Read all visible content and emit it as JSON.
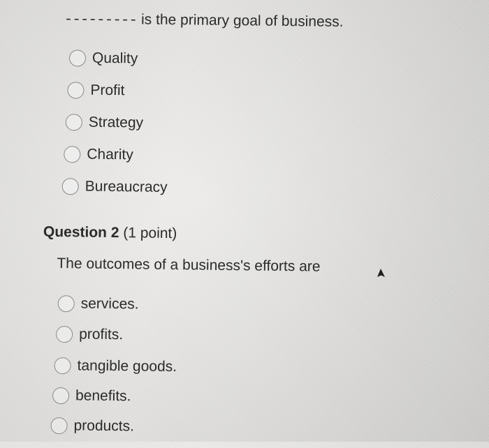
{
  "question1": {
    "blank": "---------",
    "stem": "is the primary goal of business.",
    "options": [
      "Quality",
      "Profit",
      "Strategy",
      "Charity",
      "Bureaucracy"
    ]
  },
  "question2": {
    "heading": "Question 2",
    "points": "(1 point)",
    "stem": "The outcomes of a business's efforts are",
    "options": [
      "services.",
      "profits.",
      "tangible goods.",
      "benefits.",
      "products."
    ]
  },
  "cursor_icon": "mouse-pointer-icon"
}
